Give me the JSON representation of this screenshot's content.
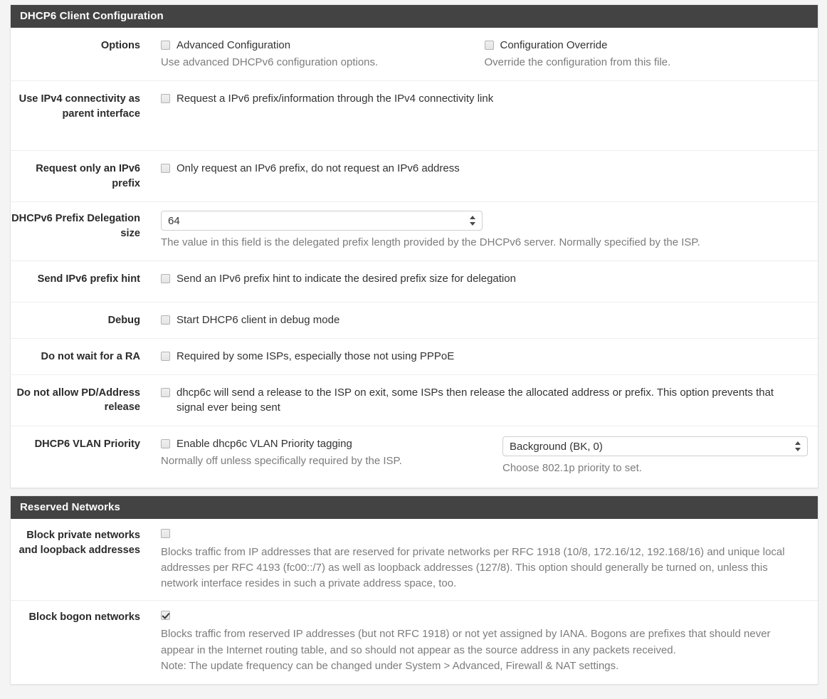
{
  "panels": [
    {
      "title": "DHCP6 Client Configuration",
      "rows": {
        "options": {
          "label": "Options",
          "left": {
            "checkbox_label": "Advanced Configuration",
            "checked": false,
            "help": "Use advanced DHCPv6 configuration options."
          },
          "right": {
            "checkbox_label": "Configuration Override",
            "checked": false,
            "help": "Override the configuration from this file."
          }
        },
        "ipv4_parent": {
          "label": "Use IPv4 connectivity as parent interface",
          "checkbox_label": "Request a IPv6 prefix/information through the IPv4 connectivity link",
          "checked": false
        },
        "prefix_only": {
          "label": "Request only an IPv6 prefix",
          "checkbox_label": "Only request an IPv6 prefix, do not request an IPv6 address",
          "checked": false
        },
        "pd_size": {
          "label": "DHCPv6 Prefix Delegation size",
          "value": "64",
          "help": "The value in this field is the delegated prefix length provided by the DHCPv6 server. Normally specified by the ISP."
        },
        "prefix_hint": {
          "label": "Send IPv6 prefix hint",
          "checkbox_label": "Send an IPv6 prefix hint to indicate the desired prefix size for delegation",
          "checked": false
        },
        "debug": {
          "label": "Debug",
          "checkbox_label": "Start DHCP6 client in debug mode",
          "checked": false
        },
        "no_ra_wait": {
          "label": "Do not wait for a RA",
          "checkbox_label": "Required by some ISPs, especially those not using PPPoE",
          "checked": false
        },
        "no_release": {
          "label": "Do not allow PD/Address release",
          "checkbox_label": "dhcp6c will send a release to the ISP on exit, some ISPs then release the allocated address or prefix. This option prevents that signal ever being sent",
          "checked": false
        },
        "vlan_priority": {
          "label": "DHCP6 VLAN Priority",
          "checkbox_label": "Enable dhcp6c VLAN Priority tagging",
          "checked": false,
          "help": "Normally off unless specifically required by the ISP.",
          "select_value": "Background (BK, 0)",
          "select_help": "Choose 802.1p priority to set."
        }
      }
    },
    {
      "title": "Reserved Networks",
      "rows": {
        "block_private": {
          "label": "Block private networks and loopback addresses",
          "checked": false,
          "help": "Blocks traffic from IP addresses that are reserved for private networks per RFC 1918 (10/8, 172.16/12, 192.168/16) and unique local addresses per RFC 4193 (fc00::/7) as well as loopback addresses (127/8). This option should generally be turned on, unless this network interface resides in such a private address space, too."
        },
        "block_bogon": {
          "label": "Block bogon networks",
          "checked": true,
          "help": "Blocks traffic from reserved IP addresses (but not RFC 1918) or not yet assigned by IANA. Bogons are prefixes that should never appear in the Internet routing table, and so should not appear as the source address in any packets received.",
          "help_note": "Note: The update frequency can be changed under System > Advanced, Firewall & NAT settings."
        }
      }
    }
  ],
  "icons": {
    "spinner_up": "caret-up-icon",
    "spinner_down": "caret-down-icon"
  },
  "colors": {
    "panel_heading_bg": "#434343",
    "panel_bg": "#ffffff",
    "page_bg": "#f4f4f4",
    "help_text": "#7c7c7c",
    "label_text": "#2b2b2b"
  }
}
